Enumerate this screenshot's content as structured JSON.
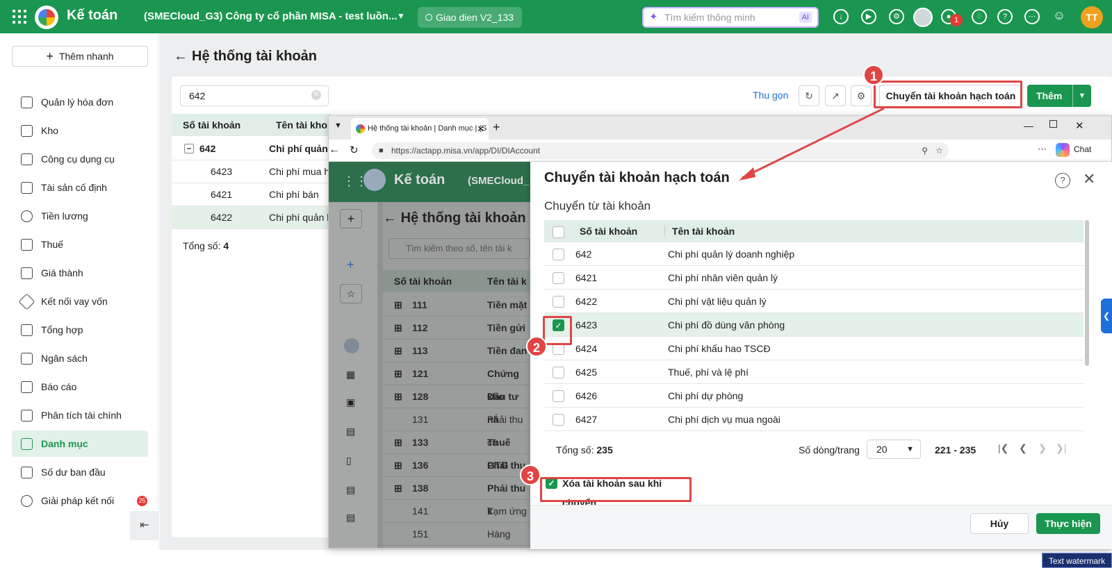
{
  "topbar": {
    "app_title": "Kế toán",
    "company": "(SMECloud_G3) Công ty cổ phần MISA - test luồn...",
    "theme": "Giao dien V2_133",
    "search_placeholder": "Tìm kiếm thông minh",
    "ai_label": "AI",
    "notification_count": "1",
    "user_initials": "TT"
  },
  "sidebar": {
    "quick_add": "Thêm nhanh",
    "items": [
      {
        "label": "Quản lý hóa đơn",
        "icon": "invoice-icon"
      },
      {
        "label": "Kho",
        "icon": "warehouse-icon"
      },
      {
        "label": "Công cụ dụng cụ",
        "icon": "tools-icon"
      },
      {
        "label": "Tài sản cố định",
        "icon": "truck-icon"
      },
      {
        "label": "Tiền lương",
        "icon": "dollar-icon"
      },
      {
        "label": "Thuế",
        "icon": "tax-icon"
      },
      {
        "label": "Giá thành",
        "icon": "tag-icon"
      },
      {
        "label": "Kết nối vay vốn",
        "icon": "loan-icon"
      },
      {
        "label": "Tổng hợp",
        "icon": "ledger-icon"
      },
      {
        "label": "Ngân sách",
        "icon": "budget-icon"
      },
      {
        "label": "Báo cáo",
        "icon": "bar-chart-icon"
      },
      {
        "label": "Phân tích tài chính",
        "icon": "analysis-icon"
      },
      {
        "label": "Danh mục",
        "icon": "list-icon"
      },
      {
        "label": "Số dư ban đầu",
        "icon": "balance-icon"
      },
      {
        "label": "Giải pháp kết nối",
        "icon": "connect-icon"
      }
    ],
    "connect_badge": "25"
  },
  "page": {
    "title": "Hệ thống tài khoản",
    "filter_value": "642",
    "collapse_link": "Thu gọn",
    "move_button": "Chuyển tài khoản hạch toán",
    "add_button": "Thêm",
    "columns": [
      "Số tài khoản",
      "Tên tài kho"
    ],
    "rows": [
      {
        "num": "642",
        "name": "Chi phí quản"
      },
      {
        "num": "6423",
        "name": "Chi phí mua h"
      },
      {
        "num": "6421",
        "name": "Chi phí bán hà"
      },
      {
        "num": "6422",
        "name": "Chi phí quản l"
      }
    ],
    "total_label": "Tổng số:",
    "total_value": "4"
  },
  "browser": {
    "tab_title": "Hệ thống tài khoản | Danh mục | (S",
    "url": "https://actapp.misa.vn/app/DI/DIAccount",
    "chat_label": "Chat",
    "inner_app_title": "Kế toán",
    "inner_company": "(SMECloud_",
    "inner_page_title": "Hệ thống tài khoản",
    "inner_search_placeholder": "Tìm kiếm theo số, tên tài k",
    "inner_columns": [
      "Số tài khoản",
      "Tên tài k"
    ],
    "inner_rows": [
      {
        "num": "111",
        "name": "Tiền mặt"
      },
      {
        "num": "112",
        "name": "Tiền gửi"
      },
      {
        "num": "113",
        "name": "Tiền đan"
      },
      {
        "num": "121",
        "name": "Chứng kho"
      },
      {
        "num": "128",
        "name": "Đầu tư nắ"
      },
      {
        "num": "131",
        "name": "Phải thu cu"
      },
      {
        "num": "133",
        "name": "Thuế GTG"
      },
      {
        "num": "136",
        "name": "Phải thu"
      },
      {
        "num": "138",
        "name": "Phải thu k"
      },
      {
        "num": "141",
        "name": "Tạm ứng"
      },
      {
        "num": "151",
        "name": "Hàng mua"
      }
    ]
  },
  "dialog": {
    "title": "Chuyển tài khoản hạch toán",
    "subtitle": "Chuyển từ tài khoản",
    "columns": [
      "Số tài khoản",
      "Tên tài khoản"
    ],
    "rows": [
      {
        "num": "642",
        "name": "Chi phí quản lý doanh nghiệp"
      },
      {
        "num": "6421",
        "name": "Chi phí nhân viên quản lý"
      },
      {
        "num": "6422",
        "name": "Chi phí vật liệu quản lý"
      },
      {
        "num": "6423",
        "name": "Chi phí đồ dùng văn phòng"
      },
      {
        "num": "6424",
        "name": "Chi phí khấu hao TSCĐ"
      },
      {
        "num": "6425",
        "name": "Thuế, phí và lệ phí"
      },
      {
        "num": "6426",
        "name": "Chi phí dự phòng"
      },
      {
        "num": "6427",
        "name": "Chi phí dịch vụ mua ngoài"
      }
    ],
    "total_label": "Tổng số:",
    "total_value": "235",
    "rows_per_page_label": "Số dòng/trang",
    "rows_per_page": "20",
    "range": "221 - 235",
    "delete_after": "Xóa tài khoản sau khi chuyển",
    "cancel": "Hủy",
    "execute": "Thực hiện"
  },
  "annotations": {
    "step1": "1",
    "step2": "2",
    "step3": "3"
  },
  "watermark": "Text watermark",
  "colors": {
    "brand": "#1a9650",
    "annotation": "#e04545",
    "link": "#1e6fd9"
  }
}
